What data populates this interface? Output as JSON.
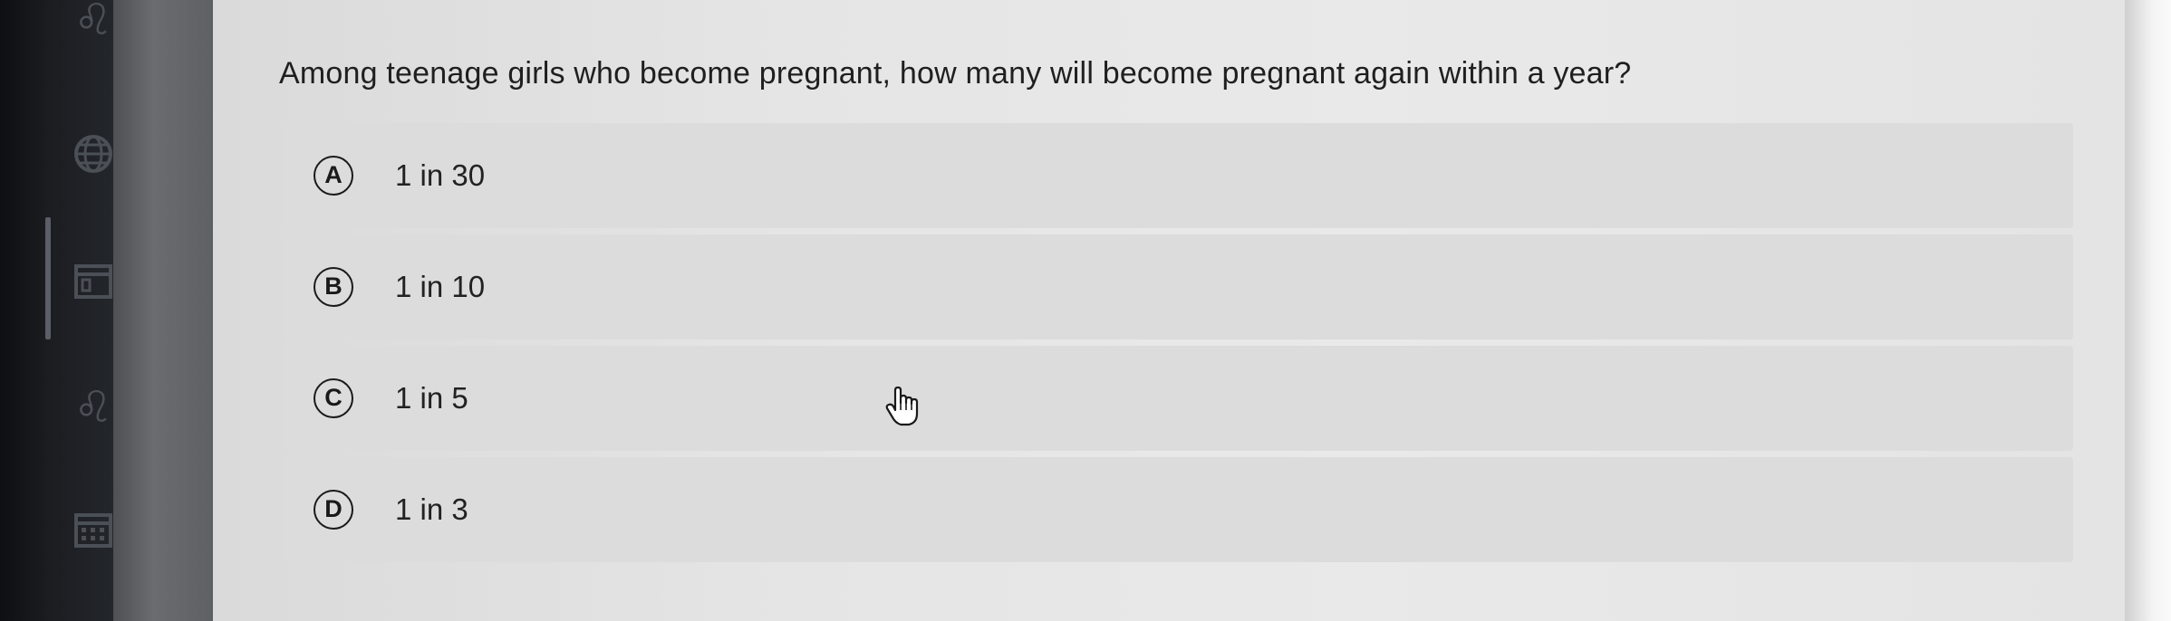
{
  "question": {
    "text": "Among teenage girls who become pregnant, how many will become pregnant again within a year?"
  },
  "options": [
    {
      "letter": "A",
      "text": "1 in 30"
    },
    {
      "letter": "B",
      "text": "1 in 10"
    },
    {
      "letter": "C",
      "text": "1 in 5"
    },
    {
      "letter": "D",
      "text": "1 in 3"
    }
  ],
  "sidebar": {
    "icons": [
      "people-icon",
      "globe-icon",
      "calendar-icon",
      "people-icon",
      "grid-calendar-icon"
    ]
  },
  "cursor": {
    "icon": "hand-pointer-icon"
  },
  "colors": {
    "content_bg": "#e6e6e6",
    "option_bg": "#dcdcdc",
    "text": "#1f1f1f",
    "sidebar_bg": "#1b1d21"
  }
}
